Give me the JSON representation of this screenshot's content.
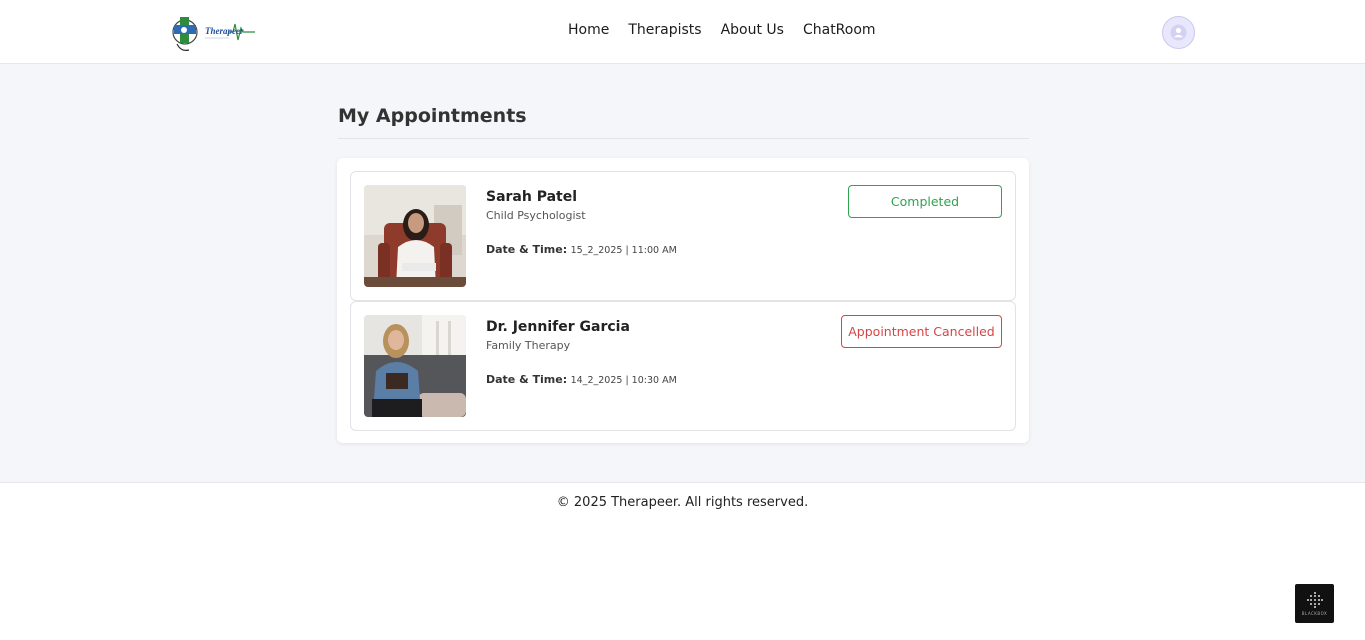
{
  "header": {
    "logo_text": "Therapeer",
    "nav": [
      {
        "label": "Home"
      },
      {
        "label": "Therapists"
      },
      {
        "label": "About Us"
      },
      {
        "label": "ChatRoom"
      }
    ]
  },
  "main": {
    "title": "My Appointments",
    "appointments": [
      {
        "name": "Sarah Patel",
        "specialty": "Child Psychologist",
        "datetime_label": "Date & Time:",
        "datetime_value": "15_2_2025 | 11:00 AM",
        "status": "Completed"
      },
      {
        "name": "Dr. Jennifer Garcia",
        "specialty": "Family Therapy",
        "datetime_label": "Date & Time:",
        "datetime_value": "14_2_2025 | 10:30 AM",
        "status": "Appointment Cancelled"
      }
    ]
  },
  "footer": {
    "copyright": "© 2025 Therapeer. All rights reserved.",
    "badge_text": "BLACKBOX"
  },
  "colors": {
    "completed": "#2ea44f",
    "cancelled": "#d64545",
    "page_bg": "#f5f6f9"
  }
}
